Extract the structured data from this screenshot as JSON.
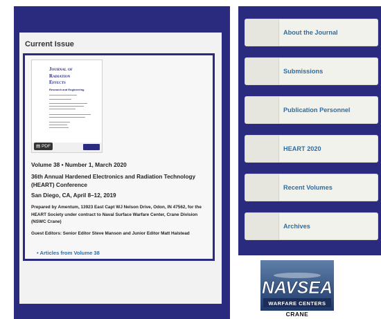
{
  "current_issue": {
    "heading": "Current Issue",
    "cover": {
      "title": "Journal of\nRadiation\nEffects",
      "subtitle": "Research and Engineering",
      "badge": "PDF"
    },
    "volume_line": "Volume 38 • Number 1, March 2020",
    "conference": "36th Annual Hardened Electronics and Radiation Technology (HEART) Conference",
    "place_date": "San Diego, CA, April 8–12, 2019",
    "prepared_by": "Prepared by Amentum, 13923 East Capt WJ Nelson Drive, Odon, IN 47562, for the HEART Society under contract to Naval Surface Warfare Center, Crane Division (NSWC Crane)",
    "guest_editors": "Guest Editors: Senior Editor Steve Manson and Junior Editor Matt Halstead",
    "articles_link": "• Articles from Volume 38"
  },
  "nav": [
    {
      "label": "About the Journal"
    },
    {
      "label": "Submissions"
    },
    {
      "label": "Publication Personnel"
    },
    {
      "label": "HEART 2020"
    },
    {
      "label": "Recent Volumes"
    },
    {
      "label": "Archives"
    }
  ],
  "logo": {
    "wordmark": "NAVSEA",
    "tagline": "WARFARE CENTERS",
    "location": "CRANE"
  },
  "colors": {
    "navy": "#2a2b7e",
    "link": "#2e6da4"
  }
}
